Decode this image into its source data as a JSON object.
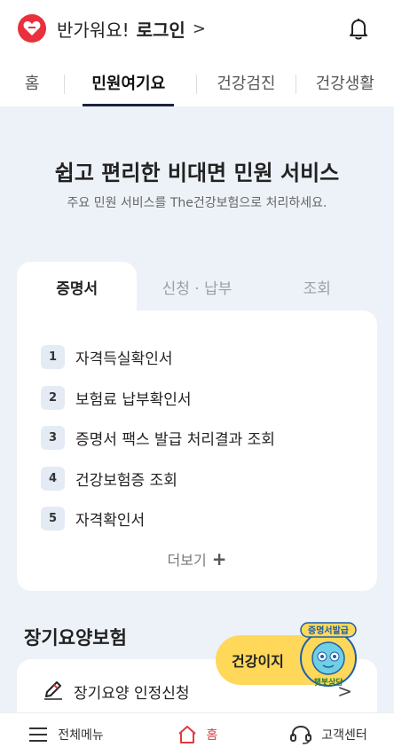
{
  "header": {
    "greeting": "반가워요!",
    "login": "로그인",
    "chevron": ">"
  },
  "nav": {
    "items": [
      {
        "label": "홈"
      },
      {
        "label": "민원여기요"
      },
      {
        "label": "건강검진"
      },
      {
        "label": "건강생활"
      }
    ],
    "active_index": 1
  },
  "hero": {
    "title": "쉽고 편리한 비대면 민원 서비스",
    "subtitle": "주요 민원 서비스를 The건강보험으로 처리하세요."
  },
  "tabs": {
    "items": [
      {
        "label": "증명서"
      },
      {
        "label": "신청 · 납부"
      },
      {
        "label": "조회"
      }
    ],
    "active_index": 0
  },
  "certificates": {
    "items": [
      {
        "num": "1",
        "label": "자격득실확인서"
      },
      {
        "num": "2",
        "label": "보험료 납부확인서"
      },
      {
        "num": "3",
        "label": "증명서 팩스 발급 처리결과 조회"
      },
      {
        "num": "4",
        "label": "건강보험증 조회"
      },
      {
        "num": "5",
        "label": "자격확인서"
      }
    ],
    "more_label": "더보기",
    "more_icon": "+"
  },
  "ltc": {
    "title": "장기요양보험",
    "item_label": "장기요양 인정신청",
    "arrow": ">"
  },
  "chatbot": {
    "label": "건강이지",
    "bubble_top": "증명서발급",
    "bubble_bottom": "챗봇상담"
  },
  "bottom_bar": {
    "menu": "전체메뉴",
    "home": "홈",
    "support": "고객센터"
  },
  "colors": {
    "brand_red": "#e8313c",
    "chat_yellow": "#ffd85a",
    "page_bg": "#edf2f8",
    "active_underline": "#1b2440"
  }
}
